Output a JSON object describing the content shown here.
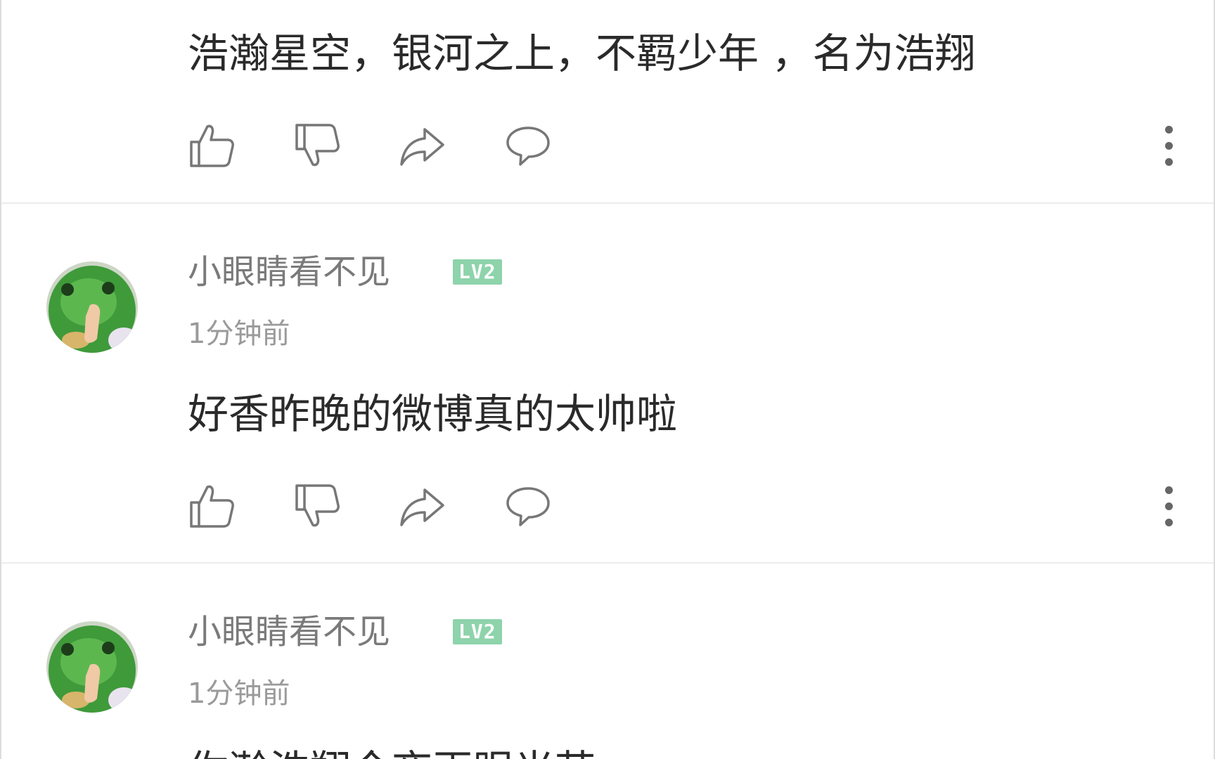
{
  "comments": [
    {
      "text": "浩瀚星空，银河之上，不羁少年 ，名为浩翔"
    },
    {
      "username": "小眼睛看不见",
      "level": "LV2",
      "time": "1分钟前",
      "text": "好香昨晚的微博真的太帅啦"
    },
    {
      "username": "小眼睛看不见",
      "level": "LV2",
      "time": "1分钟前",
      "text": "你瀚浩翔今夜再眼光芒"
    }
  ],
  "icons": {
    "like": "thumb-up-icon",
    "dislike": "thumb-down-icon",
    "share": "share-arrow-icon",
    "reply": "speech-bubble-icon",
    "more": "more-vertical-icon"
  },
  "colors": {
    "level_badge": "#8ed3ab",
    "avatar_green": "#3f9a3a"
  }
}
